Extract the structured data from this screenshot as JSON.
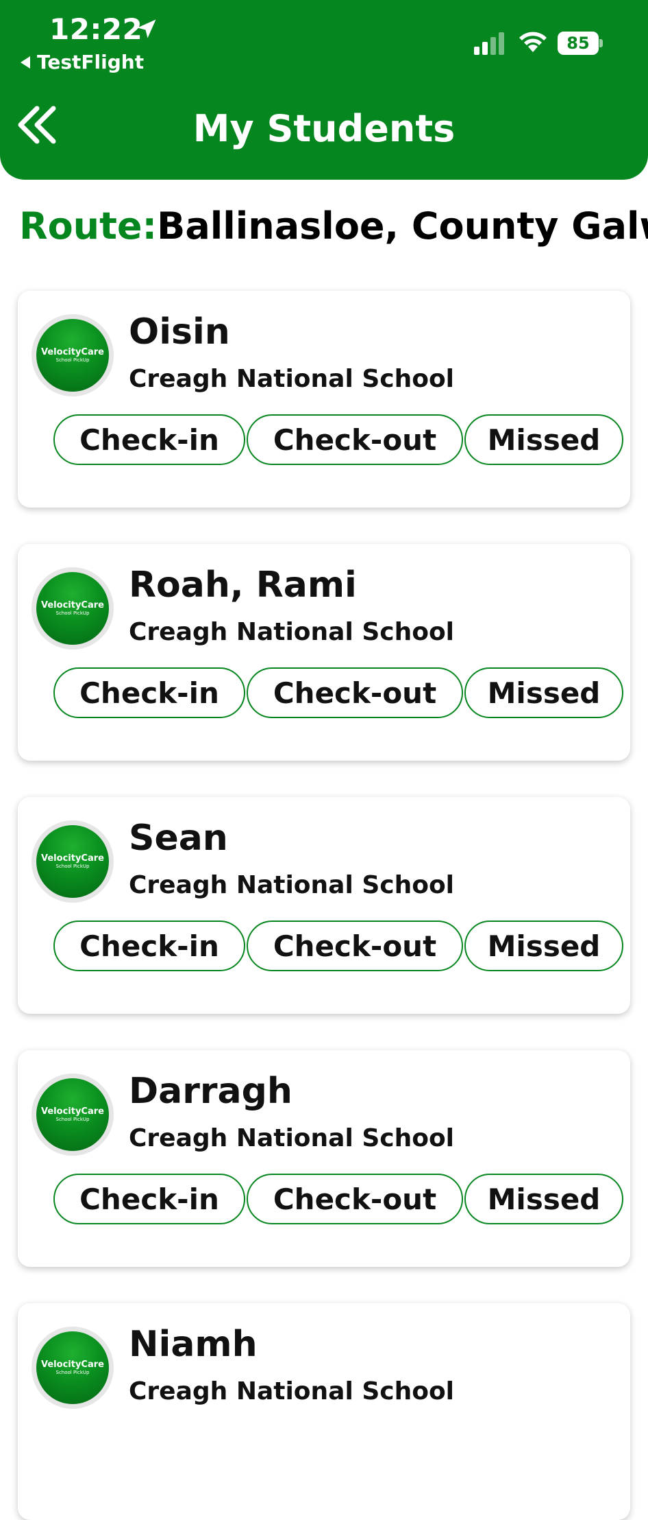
{
  "status_bar": {
    "time": "12:22",
    "back_app": "TestFlight",
    "battery": "85"
  },
  "header": {
    "title": "My Students"
  },
  "route": {
    "label": "Route:",
    "value": "Ballinasloe, County Galway"
  },
  "avatar": {
    "brand": "VelocityCare",
    "sub": "School PickUp"
  },
  "buttons": {
    "check_in": "Check-in",
    "check_out": "Check-out",
    "missed": "Missed"
  },
  "students": [
    {
      "name": "Oisin",
      "school": "Creagh National School"
    },
    {
      "name": "Roah, Rami",
      "school": "Creagh National School"
    },
    {
      "name": "Sean",
      "school": "Creagh National School"
    },
    {
      "name": "Darragh",
      "school": "Creagh National School"
    },
    {
      "name": "Niamh",
      "school": "Creagh National School"
    }
  ],
  "colors": {
    "brand_green": "#06861f",
    "text": "#111111"
  }
}
